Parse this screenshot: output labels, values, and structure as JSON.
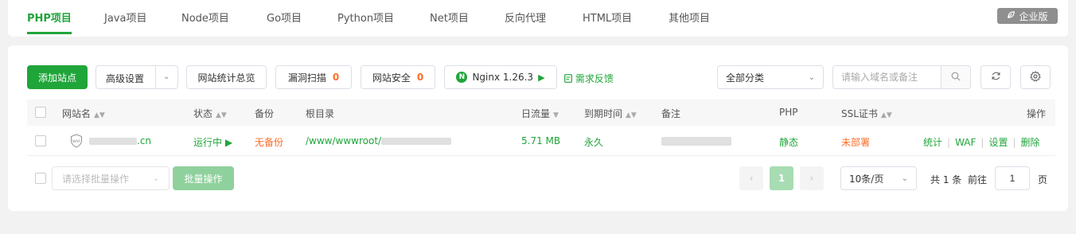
{
  "tabs": [
    {
      "label": "PHP项目"
    },
    {
      "label": "Java项目"
    },
    {
      "label": "Node项目"
    },
    {
      "label": "Go项目"
    },
    {
      "label": "Python项目"
    },
    {
      "label": "Net项目"
    },
    {
      "label": "反向代理"
    },
    {
      "label": "HTML项目"
    },
    {
      "label": "其他项目"
    }
  ],
  "enterprise_badge": "企业版",
  "toolbar": {
    "add_site": "添加站点",
    "advanced": "高级设置",
    "stats_overview": "网站统计总览",
    "vuln_scan": "漏洞扫描",
    "vuln_count": "0",
    "site_security": "网站安全",
    "security_count": "0",
    "nginx": "Nginx 1.26.3",
    "feedback": "需求反馈",
    "category": "全部分类",
    "search_placeholder": "请输入域名或备注"
  },
  "table": {
    "headers": {
      "name": "网站名",
      "status": "状态",
      "backup": "备份",
      "root": "根目录",
      "traffic": "日流量",
      "expire": "到期时间",
      "note": "备注",
      "php": "PHP",
      "ssl": "SSL证书",
      "ops": "操作"
    },
    "rows": [
      {
        "name_suffix": ".cn",
        "status": "运行中",
        "backup": "无备份",
        "root_prefix": "/www/wwwroot/",
        "traffic": "5.71 MB",
        "expire": "永久",
        "php": "静态",
        "ssl": "未部署",
        "ops": [
          "统计",
          "WAF",
          "设置",
          "删除"
        ]
      }
    ]
  },
  "footer": {
    "batch_placeholder": "请选择批量操作",
    "batch_button": "批量操作",
    "current_page": "1",
    "page_size": "10条/页",
    "total": "共 1 条",
    "goto": "前往",
    "goto_value": "1",
    "page_unit": "页"
  },
  "colors": {
    "accent": "#20a53a",
    "warning": "#fc6d26"
  }
}
